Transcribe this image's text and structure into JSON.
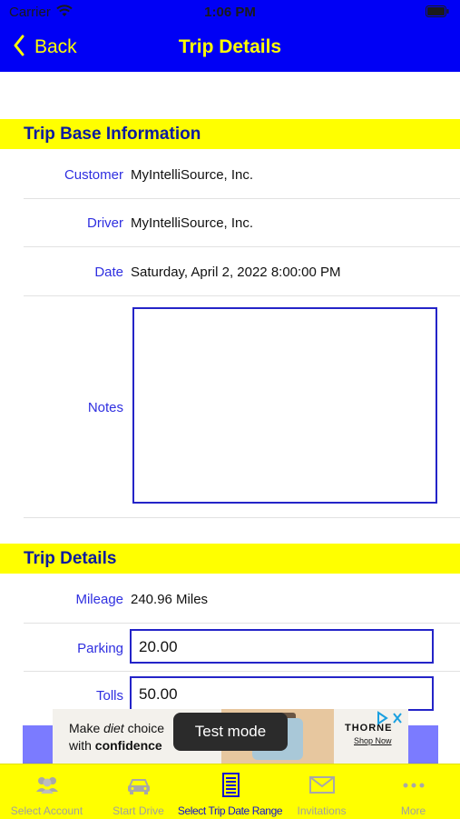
{
  "status_bar": {
    "carrier": "Carrier",
    "time": "1:06 PM"
  },
  "nav": {
    "back_label": "Back",
    "title": "Trip Details"
  },
  "base_info": {
    "heading": "Trip Base Information",
    "customer_label": "Customer",
    "customer_value": "MyIntelliSource, Inc.",
    "driver_label": "Driver",
    "driver_value": "MyIntelliSource, Inc.",
    "date_label": "Date",
    "date_value": "Saturday, April 2, 2022 8:00:00 PM",
    "notes_label": "Notes",
    "notes_value": ""
  },
  "trip_details": {
    "heading": "Trip Details",
    "mileage_label": "Mileage",
    "mileage_value": "240.96 Miles",
    "parking_label": "Parking",
    "parking_value": "20.00",
    "tolls_label": "Tolls",
    "tolls_value": "50.00"
  },
  "ad": {
    "line1_prefix": "Make ",
    "line1_em": "diet",
    "line1_suffix": " choice",
    "line2_prefix": "with ",
    "line2_bold": "confidence",
    "brand": "THORNE",
    "cta": "Shop Now"
  },
  "toast": "Test mode",
  "tabs": [
    {
      "label": "Select Account",
      "icon": "people-icon"
    },
    {
      "label": "Start Drive",
      "icon": "car-icon"
    },
    {
      "label": "Select Trip Date Range",
      "icon": "document-icon"
    },
    {
      "label": "Invitations",
      "icon": "envelope-icon"
    },
    {
      "label": "More",
      "icon": "more-icon"
    }
  ],
  "colors": {
    "header": "#0000f5",
    "accent_yellow": "#ffff00",
    "section_text": "#0a1aa0",
    "label_blue": "#2f2fe0",
    "active_tab": "#1010d0"
  }
}
